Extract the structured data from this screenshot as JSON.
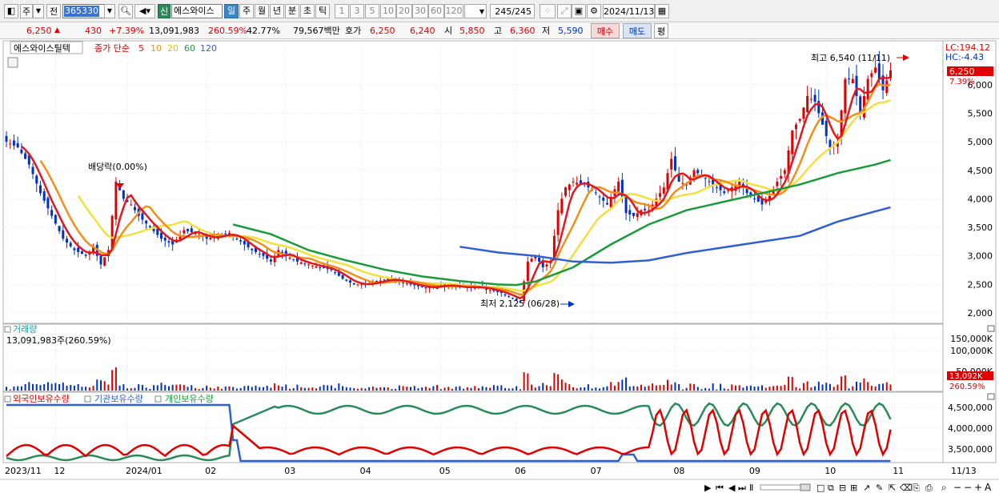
{
  "toolbar": {
    "market_label": "주",
    "prev_label": "전",
    "stock_code": "365330",
    "badge": "신",
    "stock_name": "에스와이스",
    "timeframes": [
      "일",
      "주",
      "월",
      "년",
      "분",
      "초",
      "틱"
    ],
    "active_timeframe": "일",
    "periods": [
      "1",
      "3",
      "5",
      "10",
      "20",
      "30",
      "60",
      "120"
    ],
    "count": "245/245",
    "date": "2024/11/13"
  },
  "quote": {
    "price": "6,250",
    "change_arrow": "▲",
    "change": "430",
    "change_pct": "+7.39%",
    "volume": "13,091,983",
    "volume_ratio": "260.59%",
    "turnover_pct": "42.77%",
    "amount": "79,567백만",
    "ask_label": "호가",
    "ask1": "6,250",
    "ask2": "6,240",
    "open_label": "시",
    "open": "5,850",
    "high_label": "고",
    "high": "6,360",
    "low_label": "저",
    "low": "5,590",
    "buy_label": "매수",
    "sell_label": "매도",
    "eval_label": "평"
  },
  "price_panel": {
    "legend_stock": "에스와이스틸텍",
    "legend_ma_label": "종가 단순",
    "ma_periods": [
      "5",
      "10",
      "20",
      "60",
      "120"
    ],
    "ma_colors": [
      "#e0191e",
      "#f0901a",
      "#f0e040",
      "#1a9a3a",
      "#2f5fd0"
    ],
    "lc": "LC:194.12",
    "hc": "HC:-4.43",
    "last_price_tag": "6,250",
    "last_pct_tag": "7.39%",
    "high_annotation": "최고 6,540 (11/11)",
    "low_annotation": "최저 2,125 (06/28)",
    "dividend_annotation": "배당락(0.00%)",
    "y_ticks": [
      "6,000",
      "5,500",
      "5,000",
      "4,500",
      "4,000",
      "3,500",
      "3,000",
      "2,500",
      "2,000"
    ]
  },
  "volume_panel": {
    "title": "거래량",
    "value": "13,091,983주(260.59%)",
    "y_ticks": [
      "150,000K",
      "100,000K",
      "50,000K"
    ],
    "last_tag": "13,092K",
    "last_pct_tag": "260.59%"
  },
  "holding_panel": {
    "series": [
      "외국인보유수량",
      "기관보유수량",
      "개인보유수량"
    ],
    "y_ticks": [
      "4,500,000",
      "4,000,000",
      "3,500,000"
    ]
  },
  "x_axis": {
    "labels": [
      "2023/11",
      "12",
      "2024/01",
      "02",
      "03",
      "04",
      "05",
      "06",
      "07",
      "08",
      "09",
      "10",
      "11"
    ],
    "right_label": "11/13"
  },
  "colors": {
    "up": "#e00000",
    "down": "#0030c8",
    "header_bg": "#f0f0f0"
  },
  "chart_data": {
    "type": "candlestick",
    "x_start": "2023-11",
    "x_end": "2024-11-13",
    "last_close": 6250,
    "period_high": 6540,
    "period_high_date": "11/11",
    "period_low": 2125,
    "period_low_date": "06/28",
    "ylim": [
      1850,
      6600
    ],
    "close_path": [
      [
        0,
        5000
      ],
      [
        3,
        4900
      ],
      [
        6,
        4600
      ],
      [
        9,
        4100
      ],
      [
        12,
        3700
      ],
      [
        15,
        3300
      ],
      [
        18,
        3100
      ],
      [
        21,
        3000
      ],
      [
        23,
        3150
      ],
      [
        25,
        2850
      ],
      [
        27,
        3100
      ],
      [
        29,
        4300
      ],
      [
        31,
        4000
      ],
      [
        33,
        3900
      ],
      [
        35,
        3700
      ],
      [
        38,
        3500
      ],
      [
        41,
        3300
      ],
      [
        44,
        3200
      ],
      [
        47,
        3450
      ],
      [
        50,
        3400
      ],
      [
        53,
        3300
      ],
      [
        56,
        3350
      ],
      [
        59,
        3400
      ],
      [
        62,
        3250
      ],
      [
        65,
        3100
      ],
      [
        68,
        3000
      ],
      [
        70,
        2900
      ],
      [
        72,
        3100
      ],
      [
        74,
        3000
      ],
      [
        77,
        2900
      ],
      [
        80,
        2850
      ],
      [
        83,
        2800
      ],
      [
        86,
        2750
      ],
      [
        89,
        2600
      ],
      [
        92,
        2500
      ],
      [
        95,
        2500
      ],
      [
        98,
        2550
      ],
      [
        101,
        2600
      ],
      [
        104,
        2550
      ],
      [
        107,
        2500
      ],
      [
        110,
        2450
      ],
      [
        113,
        2450
      ],
      [
        116,
        2500
      ],
      [
        119,
        2450
      ],
      [
        122,
        2450
      ],
      [
        125,
        2450
      ],
      [
        128,
        2400
      ],
      [
        131,
        2350
      ],
      [
        134,
        2250
      ],
      [
        136,
        2200
      ],
      [
        138,
        2900
      ],
      [
        140,
        3000
      ],
      [
        142,
        2800
      ],
      [
        144,
        2900
      ],
      [
        146,
        3800
      ],
      [
        148,
        4200
      ],
      [
        150,
        4300
      ],
      [
        153,
        4250
      ],
      [
        156,
        4100
      ],
      [
        159,
        3900
      ],
      [
        162,
        4300
      ],
      [
        164,
        3750
      ],
      [
        166,
        3700
      ],
      [
        168,
        3800
      ],
      [
        170,
        3800
      ],
      [
        172,
        4000
      ],
      [
        174,
        4200
      ],
      [
        176,
        4700
      ],
      [
        178,
        4300
      ],
      [
        180,
        4250
      ],
      [
        182,
        4500
      ],
      [
        184,
        4400
      ],
      [
        186,
        4300
      ],
      [
        188,
        4200
      ],
      [
        190,
        4100
      ],
      [
        192,
        4200
      ],
      [
        194,
        4300
      ],
      [
        196,
        4100
      ],
      [
        198,
        4000
      ],
      [
        200,
        3900
      ],
      [
        202,
        4050
      ],
      [
        204,
        4300
      ],
      [
        206,
        4500
      ],
      [
        208,
        5200
      ],
      [
        210,
        5400
      ],
      [
        212,
        5800
      ],
      [
        214,
        5700
      ],
      [
        216,
        5300
      ],
      [
        218,
        4900
      ],
      [
        220,
        5000
      ],
      [
        222,
        6100
      ],
      [
        224,
        6100
      ],
      [
        226,
        5500
      ],
      [
        228,
        6100
      ],
      [
        230,
        6300
      ],
      [
        232,
        5900
      ],
      [
        234,
        6250
      ]
    ],
    "ma60_path": [
      [
        60,
        3550
      ],
      [
        70,
        3380
      ],
      [
        80,
        3100
      ],
      [
        90,
        2920
      ],
      [
        100,
        2760
      ],
      [
        110,
        2640
      ],
      [
        120,
        2560
      ],
      [
        130,
        2500
      ],
      [
        135,
        2490
      ],
      [
        140,
        2550
      ],
      [
        150,
        2800
      ],
      [
        160,
        3200
      ],
      [
        170,
        3550
      ],
      [
        180,
        3800
      ],
      [
        190,
        3950
      ],
      [
        200,
        4100
      ],
      [
        210,
        4250
      ],
      [
        220,
        4450
      ],
      [
        230,
        4600
      ],
      [
        234,
        4680
      ]
    ],
    "ma120_path": [
      [
        120,
        3160
      ],
      [
        130,
        3060
      ],
      [
        140,
        3000
      ],
      [
        150,
        2900
      ],
      [
        160,
        2880
      ],
      [
        170,
        2920
      ],
      [
        180,
        3050
      ],
      [
        190,
        3150
      ],
      [
        200,
        3250
      ],
      [
        210,
        3350
      ],
      [
        220,
        3600
      ],
      [
        230,
        3780
      ],
      [
        234,
        3850
      ]
    ]
  }
}
